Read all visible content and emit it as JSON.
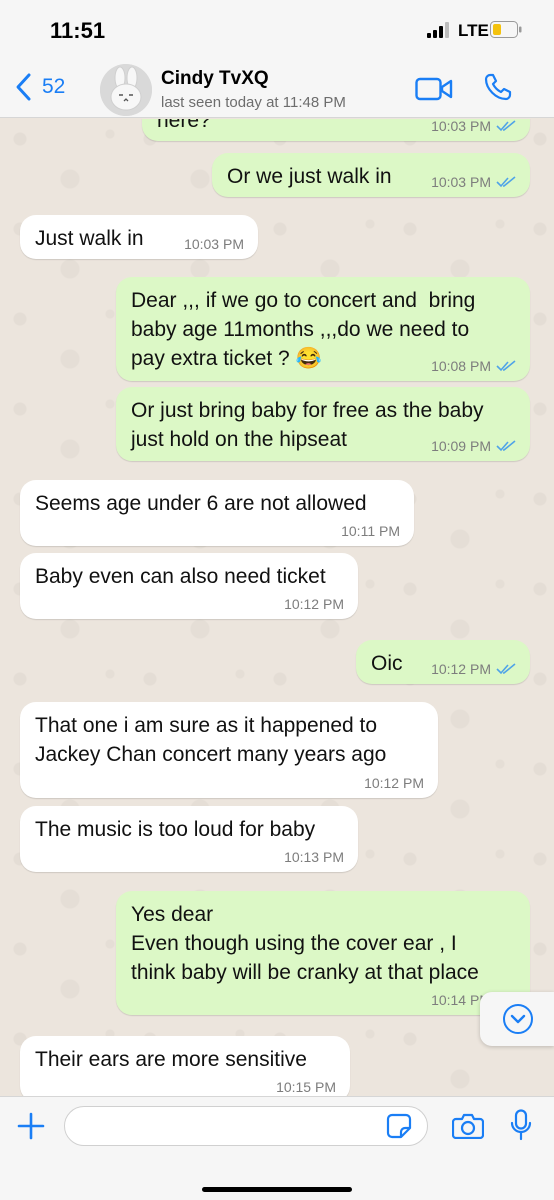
{
  "status_bar": {
    "time": "11:51",
    "network": "LTE",
    "icons": [
      "signal-icon",
      "battery-icon"
    ]
  },
  "header": {
    "back_count": "52",
    "contact_name": "Cindy TvXQ",
    "last_seen": "last seen today at 11:48 PM",
    "accent_color": "#1a7ef5"
  },
  "messages": [
    {
      "direction": "out",
      "text": "here?",
      "time": "10:03 PM",
      "read": true
    },
    {
      "direction": "out",
      "text": "Or we just walk in",
      "time": "10:03 PM",
      "read": true
    },
    {
      "direction": "in",
      "text": "Just walk in",
      "time": "10:03 PM"
    },
    {
      "direction": "out",
      "text": "Dear ,,, if we go to concert and  bring\nbaby age 11months ,,,do we need to\npay extra ticket ? 😂",
      "time": "10:08 PM",
      "read": true
    },
    {
      "direction": "out",
      "text": "Or just bring baby for free as the baby\njust hold on the hipseat",
      "time": "10:09 PM",
      "read": true
    },
    {
      "direction": "in",
      "text": "Seems age under 6 are not allowed",
      "time": "10:11 PM"
    },
    {
      "direction": "in",
      "text": "Baby even can also need ticket",
      "time": "10:12 PM"
    },
    {
      "direction": "out",
      "text": "Oic",
      "time": "10:12 PM",
      "read": true
    },
    {
      "direction": "in",
      "text": "That one i am sure as it happened to\nJackey Chan concert many years ago",
      "time": "10:12 PM"
    },
    {
      "direction": "in",
      "text": "The music is too loud for baby",
      "time": "10:13 PM"
    },
    {
      "direction": "out",
      "text": "Yes dear\nEven though using the cover ear , I\nthink baby will be cranky at that place",
      "time": "10:14 PM",
      "read": true
    },
    {
      "direction": "in",
      "text": "Their ears are more sensitive",
      "time": "10:15 PM"
    }
  ],
  "composer": {
    "placeholder": ""
  },
  "colors": {
    "outgoing_bubble": "#dcf8c6",
    "incoming_bubble": "#ffffff",
    "read_ticks": "#4fa3e8"
  }
}
